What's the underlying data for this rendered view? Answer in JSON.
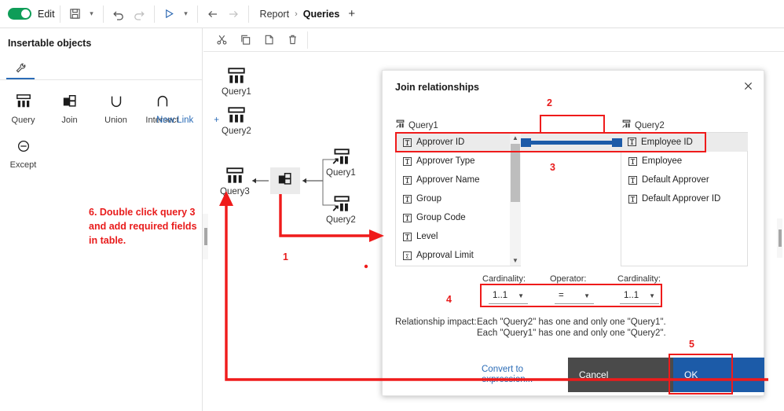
{
  "topbar": {
    "edit_label": "Edit",
    "save_icon": "save-icon",
    "undo_icon": "undo-icon",
    "redo_icon": "redo-icon",
    "run_icon": "run-icon",
    "back_icon": "back-arrow-icon",
    "forward_icon": "forward-arrow-icon",
    "breadcrumbs": [
      {
        "label": "Report",
        "active": false
      },
      {
        "label": "Queries",
        "active": true
      }
    ],
    "separator": "›",
    "add_tab": "+"
  },
  "left_panel": {
    "title": "Insertable objects",
    "tab_icon": "wrench-icon",
    "items": [
      {
        "label": "Query",
        "icon": "query-icon"
      },
      {
        "label": "Join",
        "icon": "join-icon"
      },
      {
        "label": "Union",
        "icon": "union-icon"
      },
      {
        "label": "Intersect",
        "icon": "intersect-icon"
      },
      {
        "label": "Except",
        "icon": "except-icon"
      }
    ]
  },
  "canvas": {
    "toolbar": [
      {
        "name": "cut-icon",
        "title": "Cut"
      },
      {
        "name": "copy-icon",
        "title": "Copy"
      },
      {
        "name": "paste-icon",
        "title": "Paste"
      },
      {
        "name": "delete-icon",
        "title": "Delete"
      }
    ],
    "nodes": [
      {
        "label": "Query1",
        "type": "query"
      },
      {
        "label": "Query2",
        "type": "query"
      },
      {
        "label": "Query3",
        "type": "query"
      },
      {
        "label": "Query1",
        "type": "query-shortcut"
      },
      {
        "label": "Query2",
        "type": "query-shortcut"
      }
    ],
    "join_node_icon": "join-icon"
  },
  "dialog": {
    "title": "Join relationships",
    "close_icon": "close-icon",
    "new_link_label": "New Link",
    "new_link_plus": "+",
    "left_query": "Query1",
    "right_query": "Query2",
    "left_fields": [
      {
        "label": "Approver ID",
        "icon": "text-field-icon",
        "selected": true
      },
      {
        "label": "Approver Type",
        "icon": "text-field-icon",
        "selected": false
      },
      {
        "label": "Approver Name",
        "icon": "text-field-icon",
        "selected": false
      },
      {
        "label": "Group",
        "icon": "text-field-icon",
        "selected": false
      },
      {
        "label": "Group Code",
        "icon": "text-field-icon",
        "selected": false
      },
      {
        "label": "Level",
        "icon": "text-field-icon",
        "selected": false
      },
      {
        "label": "Approval Limit",
        "icon": "measure-field-icon",
        "selected": false
      }
    ],
    "right_fields": [
      {
        "label": "Employee ID",
        "icon": "text-field-icon",
        "selected": true
      },
      {
        "label": "Employee",
        "icon": "text-field-icon",
        "selected": false
      },
      {
        "label": "Default Approver",
        "icon": "text-field-icon",
        "selected": false
      },
      {
        "label": "Default Approver ID",
        "icon": "text-field-icon",
        "selected": false
      }
    ],
    "cardinality_left_label": "Cardinality:",
    "operator_label": "Operator:",
    "cardinality_right_label": "Cardinality:",
    "cardinality_left_value": "1..1",
    "operator_value": "=",
    "cardinality_right_value": "1..1",
    "impact_label": "Relationship impact:",
    "impact_line1": "Each \"Query2\" has one and only one \"Query1\".",
    "impact_line2": "Each \"Query1\" has one and only one \"Query2\".",
    "convert_label": "Convert to expression...",
    "cancel_label": "Cancel",
    "ok_label": "OK"
  },
  "annotations": {
    "n1": "1",
    "n2": "2",
    "n3": "3",
    "n4": "4",
    "n5": "5",
    "note6": "6. Double click query 3 and add required fields in table."
  },
  "colors": {
    "accent_blue": "#1c5ba8",
    "link_blue": "#2b6cb7",
    "annotation_red": "#ef1b1b",
    "toggle_green": "#0f9d58",
    "cancel_gray": "#4a4a4a"
  }
}
